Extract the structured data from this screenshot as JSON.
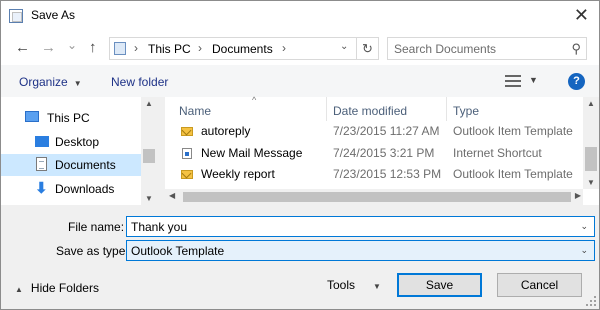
{
  "window": {
    "title": "Save As",
    "close_glyph": "✕"
  },
  "navigation": {
    "back_glyph": "←",
    "forward_glyph": "→",
    "recent_glyph": "⌄",
    "up_glyph": "↑"
  },
  "address_bar": {
    "breadcrumbs": [
      "This PC",
      "Documents"
    ],
    "separator": "›",
    "dropdown_glyph": "⌄",
    "refresh_glyph": "↻"
  },
  "search": {
    "placeholder": "Search Documents",
    "value": "",
    "icon_glyph": "⚲"
  },
  "toolbar": {
    "organize_label": "Organize",
    "new_folder_label": "New folder",
    "help_label": "?",
    "caret_glyph": "▼"
  },
  "nav_pane": {
    "items": [
      {
        "label": "This PC",
        "icon": "computer-icon",
        "selected": false
      },
      {
        "label": "Desktop",
        "icon": "desktop-icon",
        "selected": false
      },
      {
        "label": "Documents",
        "icon": "documents-icon",
        "selected": true
      },
      {
        "label": "Downloads",
        "icon": "downloads-icon",
        "selected": false
      }
    ],
    "scroll_up_glyph": "▲",
    "scroll_down_glyph": "▼"
  },
  "file_list": {
    "columns": [
      "Name",
      "Date modified",
      "Type"
    ],
    "sort_glyph": "^",
    "rows": [
      {
        "name": "autoreply",
        "date": "7/23/2015 11:27 AM",
        "type": "Outlook Item Template",
        "icon": "envelope-icon"
      },
      {
        "name": "New Mail Message",
        "date": "7/24/2015 3:21 PM",
        "type": "Internet Shortcut",
        "icon": "shortcut-icon"
      },
      {
        "name": "Weekly report",
        "date": "7/23/2015 12:53 PM",
        "type": "Outlook Item Template",
        "icon": "envelope-icon"
      }
    ],
    "scroll_left_glyph": "◀",
    "scroll_right_glyph": "▶"
  },
  "form": {
    "file_name_label": "File name:",
    "file_name_value": "Thank you",
    "save_as_type_label": "Save as type:",
    "save_as_type_value": "Outlook Template",
    "dropdown_glyph": "⌄"
  },
  "footer": {
    "hide_folders_label": "Hide Folders",
    "hide_caret_glyph": "▲",
    "tools_label": "Tools",
    "tools_caret_glyph": "▼",
    "save_label": "Save",
    "cancel_label": "Cancel"
  },
  "colors": {
    "selection": "#cce8ff",
    "focus_border": "#0078d7",
    "link_text": "#1e3287",
    "help_blue": "#1565c0"
  }
}
